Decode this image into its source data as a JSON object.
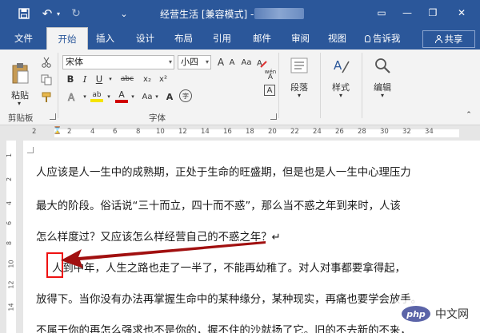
{
  "titlebar": {
    "title": "经营生活 [兼容模式] -",
    "qa": {
      "save": "💾",
      "undo": "↶",
      "redo": "↻",
      "customize": "⌄"
    },
    "win": {
      "minimize": "—",
      "restore": "❐",
      "close": "✕",
      "ribbon_toggle": "▭"
    }
  },
  "tabs": [
    "文件",
    "开始",
    "插入",
    "设计",
    "布局",
    "引用",
    "邮件",
    "审阅",
    "视图"
  ],
  "tellme": "告诉我",
  "share": "共享",
  "ribbon": {
    "paste": "粘贴",
    "clipboard": "剪贴板",
    "font_name": "宋体",
    "font_size": "小四",
    "font_group": "字体",
    "paragraph": "段落",
    "styles": "样式",
    "editing": "编辑",
    "wen_a": "wén",
    "wen_b": "A",
    "char_border": "A",
    "enclose": "字",
    "bold": "B",
    "italic": "I",
    "underline": "U",
    "strike": "abc",
    "sub": "x₂",
    "sup": "x²",
    "highlight": "ab",
    "font_color": "A",
    "case": "Aa",
    "grow": "A",
    "shrink": "A",
    "aa": "Aa",
    "caret": "▾"
  },
  "ruler": {
    "nums": [
      "2",
      "2",
      "4",
      "6",
      "8",
      "10",
      "12",
      "14",
      "16",
      "18",
      "20",
      "22",
      "24",
      "26",
      "28",
      "30",
      "32",
      "34"
    ]
  },
  "vruler": {
    "nums": [
      "1",
      "2",
      "4",
      "6",
      "8",
      "10",
      "12",
      "14"
    ]
  },
  "document": {
    "lines": [
      "人应该是人一生中的成熟期，正处于生命的旺盛期，但是也是人一生中心理压力",
      "最大的阶段。俗话说“三十而立，四十而不惑”，那么当不惑之年到来时，人该",
      "怎么样度过？又应该怎么样经营自己的不惑之年？↵",
      "人到中年，人生之路也走了一半了，不能再幼稚了。对人对事都要拿得起，",
      "放得下。当你没有办法再掌握生命中的某种缘分，某种现实，再痛也要学会放手。",
      "不属于你的再怎么强求也不是你的，握不住的沙就扬了它。旧的不去新的不来，"
    ]
  },
  "watermark": {
    "logo": "php",
    "text": "中文网"
  },
  "colors": {
    "accent": "#2b579a",
    "highlight": "#f5e400",
    "font_color": "#d10000",
    "arrow": "#a11010"
  }
}
